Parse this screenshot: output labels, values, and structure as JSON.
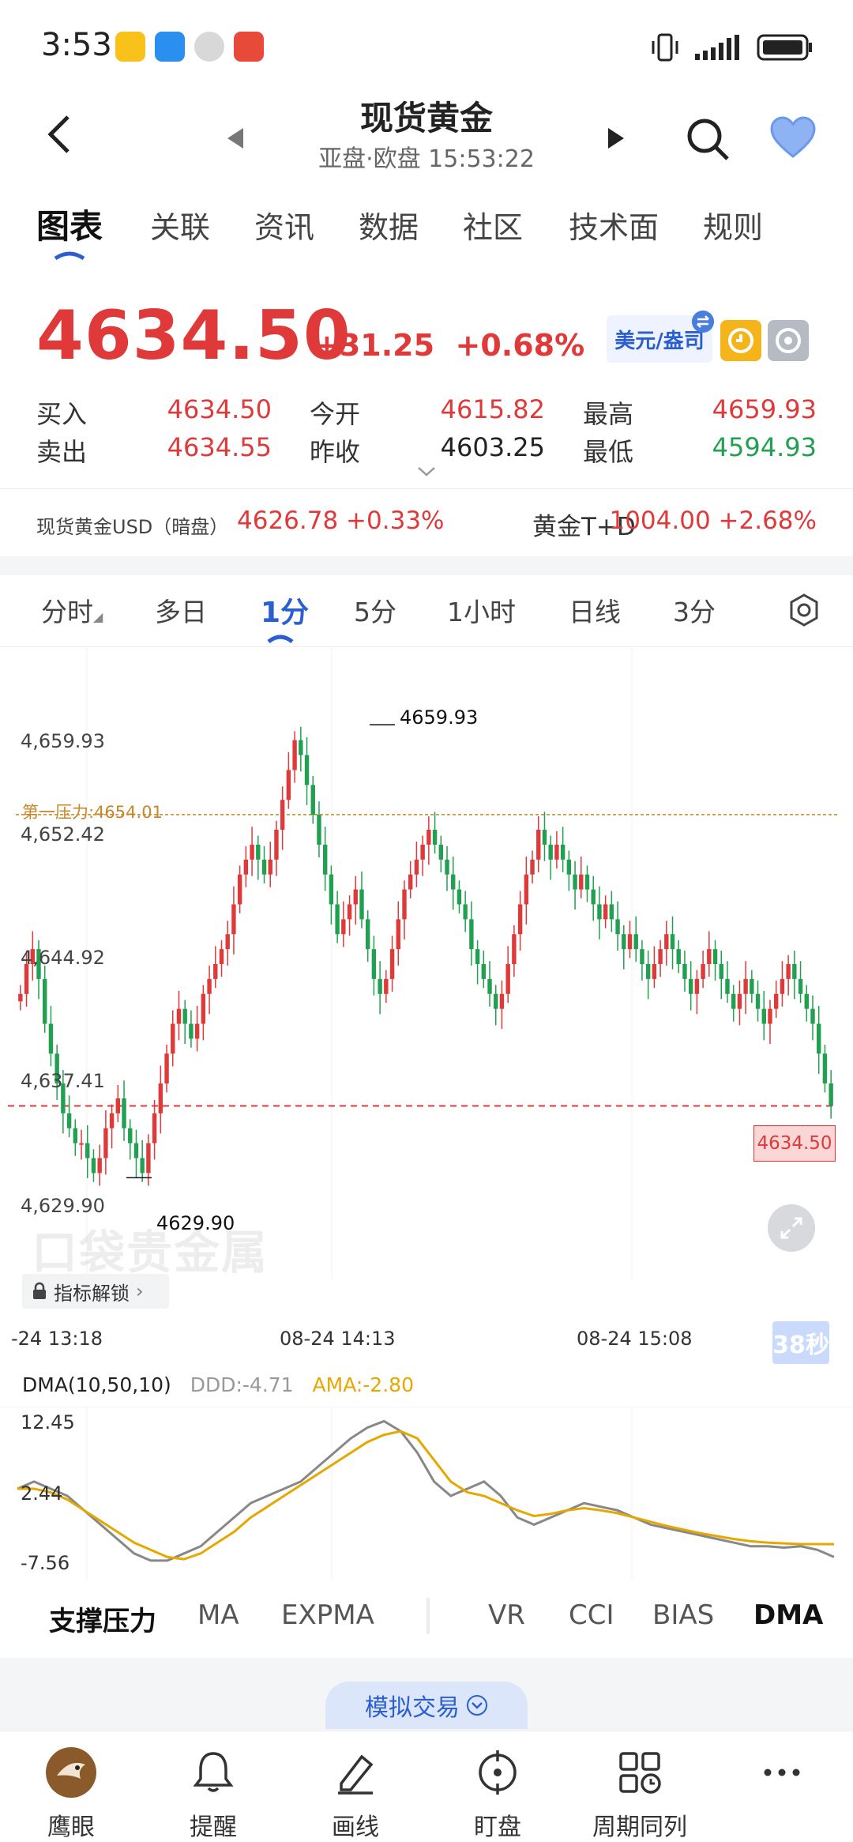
{
  "status_bar": {
    "time": "3:53"
  },
  "header": {
    "title": "现货黄金",
    "subtitle": "亚盘·欧盘  15:53:22"
  },
  "tabs": [
    "图表",
    "关联",
    "资讯",
    "数据",
    "社区",
    "技术面",
    "规则"
  ],
  "quote": {
    "price": "4634.50",
    "change": "+31.25",
    "change_pct": "+0.68%",
    "currency_button": "美元/盎司",
    "rows": [
      {
        "l1": "买入",
        "v1": "4634.50",
        "l2": "今开",
        "v2": "4615.82",
        "l3": "最高",
        "v3": "4659.93"
      },
      {
        "l1": "卖出",
        "v1": "4634.55",
        "l2": "昨收",
        "v2": "4603.25",
        "l3": "最低",
        "v3": "4594.93"
      }
    ]
  },
  "related": {
    "label1": "现货黄金USD（暗盘）",
    "value1": "4626.78 +0.33%",
    "label2": "黄金T+D",
    "value2": "1004.00 +2.68%"
  },
  "period_tabs": [
    "分时",
    "多日",
    "1分",
    "5分",
    "1小时",
    "日线",
    "3分"
  ],
  "chart": {
    "y_ticks": [
      "4,659.93",
      "4,652.42",
      "4,644.92",
      "4,637.41",
      "4,629.90"
    ],
    "x_ticks": [
      "-24 13:18",
      "08-24 14:13",
      "08-24 15:08"
    ],
    "pressure_label": "第一压力:4654.01",
    "high_label": "4659.93",
    "low_label": "4629.90",
    "price_tag": "4634.50",
    "watermark": "口袋贵金属",
    "unlock_button": "指标解锁",
    "countdown": "38秒"
  },
  "chart_data": {
    "type": "candlestick",
    "ylim": [
      4626,
      4662
    ],
    "last_price": 4634.5,
    "pressure_level": 4654.01,
    "high": 4659.93,
    "low": 4629.9,
    "closes": [
      4642,
      4644,
      4645,
      4643,
      4640,
      4638,
      4636,
      4634,
      4633,
      4632,
      4632,
      4631,
      4630,
      4631,
      4633,
      4634,
      4635,
      4633,
      4632,
      4631,
      4630,
      4632,
      4634,
      4636,
      4638,
      4640,
      4641,
      4640,
      4639,
      4640,
      4642,
      4643,
      4644,
      4645,
      4646,
      4648,
      4650,
      4651,
      4652,
      4651,
      4650,
      4651,
      4653,
      4655,
      4657,
      4659,
      4658,
      4656,
      4654,
      4652,
      4650,
      4648,
      4646,
      4647,
      4648,
      4649,
      4647,
      4645,
      4643,
      4642,
      4643,
      4645,
      4647,
      4649,
      4650,
      4651,
      4652,
      4653,
      4652,
      4651,
      4650,
      4649,
      4648,
      4647,
      4645,
      4644,
      4643,
      4642,
      4641,
      4642,
      4644,
      4646,
      4648,
      4650,
      4651,
      4653,
      4652,
      4651,
      4652,
      4651,
      4650,
      4649,
      4650,
      4649,
      4648,
      4647,
      4648,
      4647,
      4646,
      4645,
      4646,
      4645,
      4644,
      4643,
      4644,
      4645,
      4646,
      4645,
      4644,
      4643,
      4642,
      4643,
      4644,
      4645,
      4644,
      4643,
      4642,
      4641,
      4642,
      4643,
      4642,
      4641,
      4640,
      4641,
      4642,
      4643,
      4644,
      4643,
      4642,
      4641,
      4640,
      4638,
      4636,
      4634.5
    ],
    "x_labels": [
      "-24 13:18",
      "08-24 14:13",
      "08-24 15:08"
    ]
  },
  "indicator": {
    "name": "DMA(10,50,10)",
    "ddd": "DDD:-4.71",
    "ama": "AMA:-2.80",
    "ticks": [
      "12.45",
      "2.44",
      "-7.56"
    ]
  },
  "indicator_data": {
    "type": "line",
    "ylim": [
      -7.56,
      12.45
    ],
    "series": [
      {
        "name": "DDD",
        "color": "#888888",
        "values": [
          3,
          4,
          3,
          2,
          0,
          -2,
          -4,
          -6,
          -7,
          -7,
          -6,
          -5,
          -3,
          -1,
          1,
          2,
          3,
          4,
          6,
          8,
          10,
          11.5,
          12.4,
          11,
          8,
          4,
          2,
          3,
          4,
          2,
          -1,
          -2,
          -1,
          0,
          1,
          0.5,
          0,
          -1,
          -2,
          -2.5,
          -3,
          -3.5,
          -4,
          -4.5,
          -5,
          -5,
          -5.2,
          -5,
          -5.5,
          -6.5
        ]
      },
      {
        "name": "AMA",
        "color": "#e6a800",
        "values": [
          3,
          3,
          2.5,
          1.5,
          0,
          -1.5,
          -3,
          -4.5,
          -5.5,
          -6.5,
          -6.8,
          -6,
          -4.5,
          -3,
          -1,
          0.5,
          2,
          3.5,
          5,
          6.5,
          8,
          9.5,
          10.5,
          11,
          10,
          7,
          4,
          2.5,
          2,
          1,
          0,
          -0.8,
          -0.5,
          0,
          0.3,
          0,
          -0.4,
          -1,
          -1.6,
          -2.2,
          -2.7,
          -3.2,
          -3.6,
          -4,
          -4.3,
          -4.5,
          -4.6,
          -4.7,
          -4.7,
          -4.71
        ]
      }
    ]
  },
  "indicator_tabs": [
    "支撑压力",
    "MA",
    "EXPMA",
    "VR",
    "CCI",
    "BIAS",
    "DMA"
  ],
  "sim_trade": "模拟交易",
  "bottom_nav": [
    "鹰眼",
    "提醒",
    "画线",
    "盯盘",
    "周期同列",
    "···"
  ],
  "colors": {
    "up": "#e0393a",
    "down": "#20a050",
    "accent": "#2b5fcf",
    "pressure": "#c8862a"
  }
}
